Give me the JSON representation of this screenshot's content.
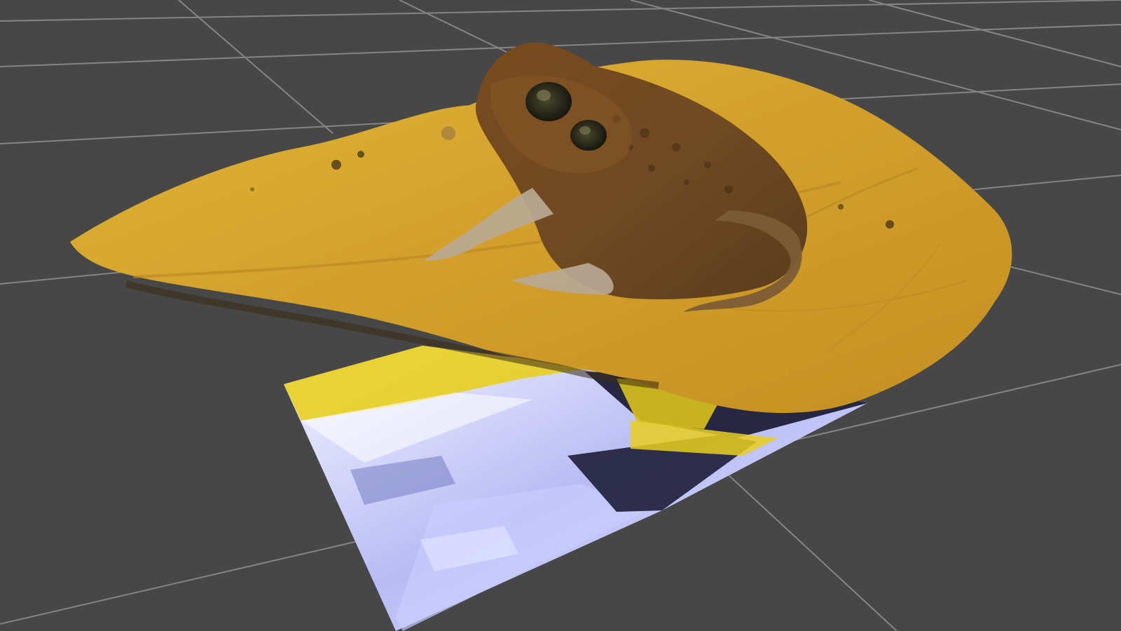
{
  "viewport": {
    "background_color": "#474747",
    "grid_line_color": "#8c8c8c"
  },
  "scene": {
    "model": {
      "subject": "toad",
      "base": "leaf",
      "leaf_color": "#d7a52c",
      "toad_body_color": "#8a5a28",
      "toad_eye_color": "#2d2a1a"
    },
    "texture_plane": {
      "colors": [
        "#e8cf1e",
        "#b9bdf0",
        "#1f1f3a",
        "#f4f4ff"
      ]
    }
  }
}
